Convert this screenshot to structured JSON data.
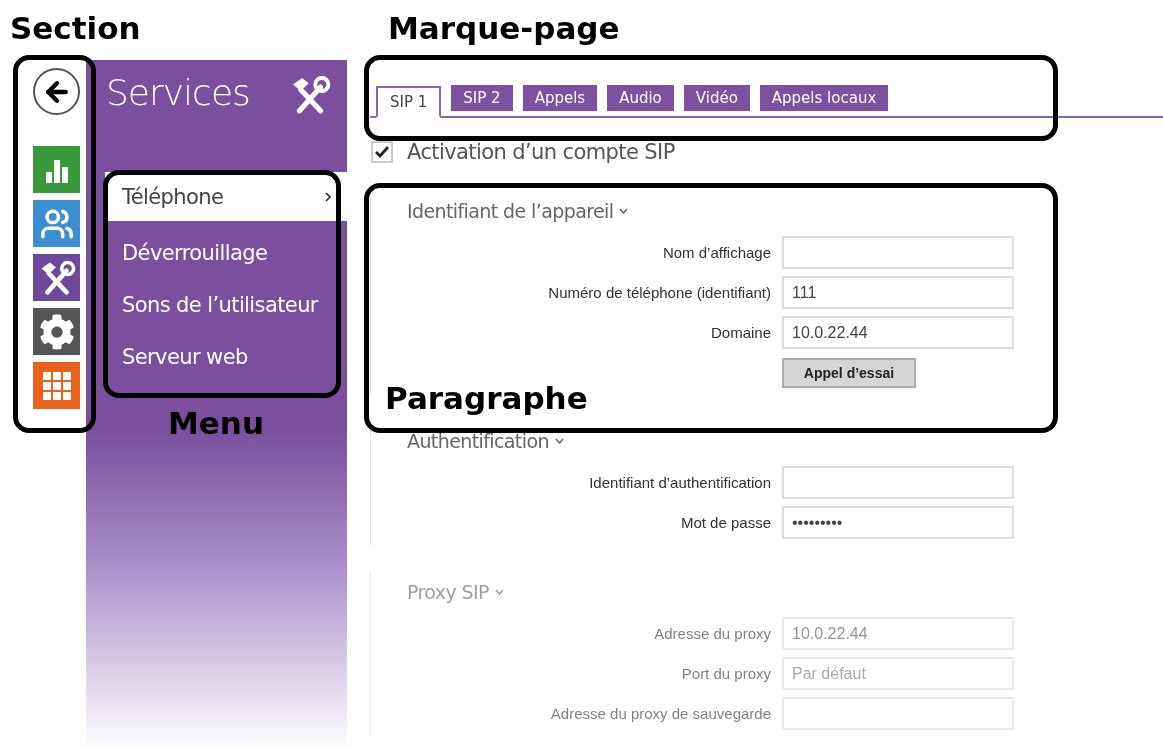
{
  "rail": {
    "items": [
      {
        "kind": "back"
      },
      {
        "kind": "chart",
        "color": "#3a9a3b"
      },
      {
        "kind": "users",
        "color": "#3b8fd0"
      },
      {
        "kind": "tools",
        "color": "#70489a"
      },
      {
        "kind": "gear",
        "color": "#555555"
      },
      {
        "kind": "grid",
        "color": "#e8621c"
      }
    ]
  },
  "sidebar": {
    "title": "Services",
    "menu": [
      {
        "label": "Téléphone",
        "selected": true
      },
      {
        "label": "Déverrouillage",
        "selected": false
      },
      {
        "label": "Sons de l’utilisateur",
        "selected": false
      },
      {
        "label": "Serveur web",
        "selected": false
      }
    ]
  },
  "tabs": [
    {
      "label": "SIP 1",
      "selected": true
    },
    {
      "label": "SIP 2",
      "selected": false
    },
    {
      "label": "Appels",
      "selected": false
    },
    {
      "label": "Audio",
      "selected": false
    },
    {
      "label": "Vidéo",
      "selected": false
    },
    {
      "label": "Appels locaux",
      "selected": false
    }
  ],
  "sip_account": {
    "label": "Activation d’un compte SIP",
    "checked": true
  },
  "sections": [
    {
      "title": "Identifiant de l’appareil",
      "disabled": false,
      "fields": [
        {
          "label": "Nom d’affichage"
        },
        {
          "label": "Numéro de téléphone (identifiant)",
          "value": "111"
        },
        {
          "label": "Domaine",
          "value": "10.0.22.44"
        }
      ],
      "button": "Appel d’essai"
    },
    {
      "title": "Authentification",
      "disabled": false,
      "fields": [
        {
          "label": "Identifiant d’authentification"
        },
        {
          "label": "Mot de passe",
          "value": "•••••••••"
        }
      ]
    },
    {
      "title": "Proxy SIP",
      "disabled": true,
      "fields": [
        {
          "label": "Adresse du proxy",
          "value": "10.0.22.44"
        },
        {
          "label": "Port du proxy",
          "placeholder": "Par défaut"
        },
        {
          "label": "Adresse du proxy de sauvegarde"
        }
      ]
    }
  ],
  "annotations": [
    {
      "text": "Section"
    },
    {
      "text": "Marque-page"
    },
    {
      "text": "Menu"
    },
    {
      "text": "Paragraphe"
    }
  ]
}
